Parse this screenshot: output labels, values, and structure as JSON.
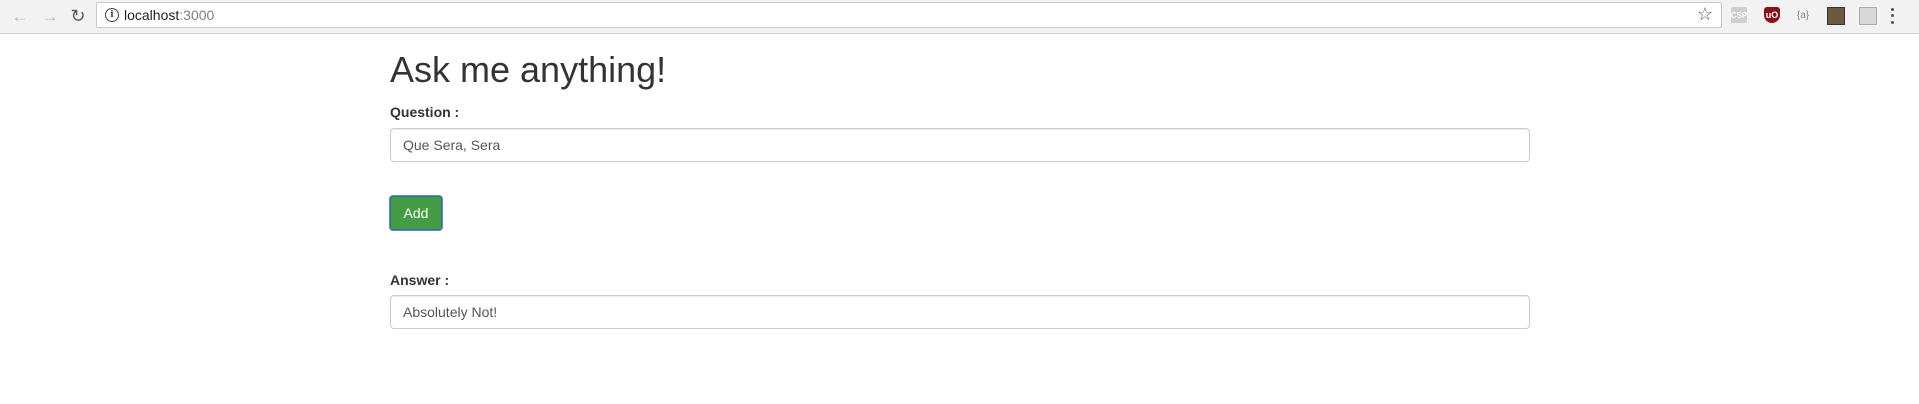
{
  "browser": {
    "url_host": "localhost",
    "url_port": ":3000",
    "extensions": [
      "csp-icon",
      "ublock-origin-icon",
      "json-viewer-icon",
      "image-extension-icon",
      "grid-extension-icon"
    ]
  },
  "page": {
    "title": "Ask me anything!",
    "question_label": "Question :",
    "question_value": "Que Sera, Sera",
    "add_button": "Add",
    "answer_label": "Answer :",
    "answer_value": "Absolutely Not!"
  },
  "colors": {
    "add_button_bg": "#449d44",
    "add_button_focus_border": "#2e6da4"
  }
}
